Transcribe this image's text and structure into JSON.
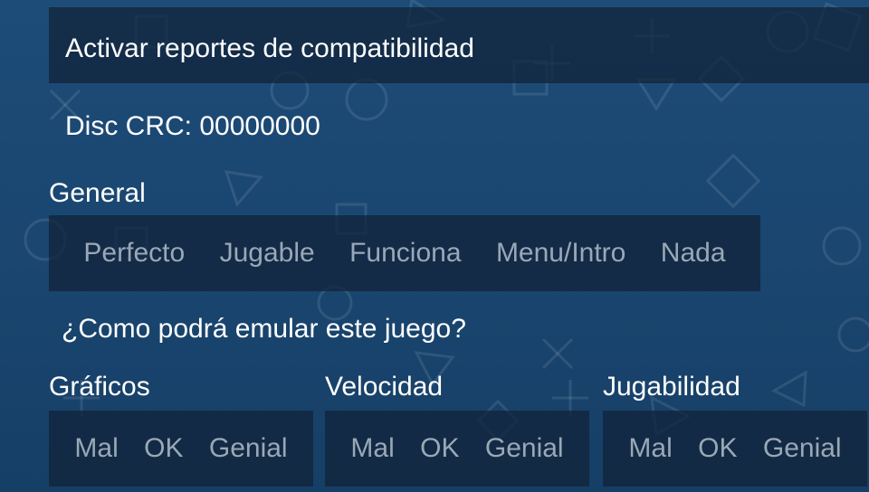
{
  "compat_toggle": {
    "label": "Activar reportes de compatibilidad"
  },
  "disc_crc": "Disc CRC: 00000000",
  "general": {
    "header": "General",
    "options": [
      "Perfecto",
      "Jugable",
      "Funciona",
      "Menu/Intro",
      "Nada"
    ]
  },
  "question": "¿Como podrá emular este juego?",
  "categories": [
    {
      "header": "Gráficos",
      "options": [
        "Mal",
        "OK",
        "Genial"
      ]
    },
    {
      "header": "Velocidad",
      "options": [
        "Mal",
        "OK",
        "Genial"
      ]
    },
    {
      "header": "Jugabilidad",
      "options": [
        "Mal",
        "OK",
        "Genial"
      ]
    }
  ],
  "colors": {
    "background": "#1a4670",
    "panel": "#102138",
    "text": "#ffffff",
    "option_text": "#9aa8b6"
  },
  "background_icons": [
    "cross-icon",
    "circle-icon",
    "square-icon",
    "triangle-icon"
  ]
}
